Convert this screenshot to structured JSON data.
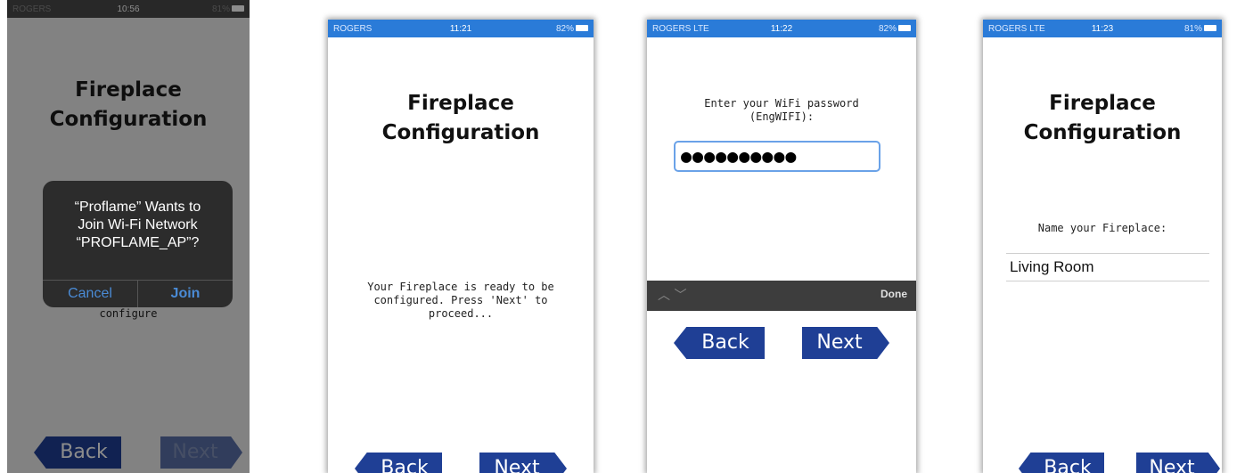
{
  "phone1": {
    "status": {
      "carrier": "ROGERS",
      "time": "10:56",
      "battery": "81%"
    },
    "title_line1": "Fireplace",
    "title_line2": "Configuration",
    "alert": {
      "line1": "“Proflame” Wants to",
      "line2": "Join Wi-Fi Network",
      "line3": "“PROFLAME_AP”?",
      "cancel": "Cancel",
      "join": "Join"
    },
    "bg_text": "configure",
    "back": "Back",
    "next": "Next"
  },
  "phone2": {
    "status": {
      "carrier": "ROGERS",
      "time": "11:21",
      "battery": "82%"
    },
    "title_line1": "Fireplace",
    "title_line2": "Configuration",
    "message_line1": "Your Fireplace is ready to be",
    "message_line2": "configured. Press 'Next' to",
    "message_line3": "proceed...",
    "back": "Back",
    "next": "Next"
  },
  "phone3": {
    "status": {
      "carrier": "ROGERS LTE",
      "time": "11:22",
      "battery": "82%"
    },
    "prompt_line1": "Enter your WiFi password",
    "prompt_line2": "(EngWIFI):",
    "password_value": "●●●●●●●●●●",
    "kb_arrows": "︿ ﹀",
    "kb_done": "Done",
    "back": "Back",
    "next": "Next"
  },
  "phone4": {
    "status": {
      "carrier": "ROGERS LTE",
      "time": "11:23",
      "battery": "81%"
    },
    "title_line1": "Fireplace",
    "title_line2": "Configuration",
    "name_label": "Name your Fireplace:",
    "name_value": "Living Room",
    "back": "Back",
    "next": "Next"
  }
}
